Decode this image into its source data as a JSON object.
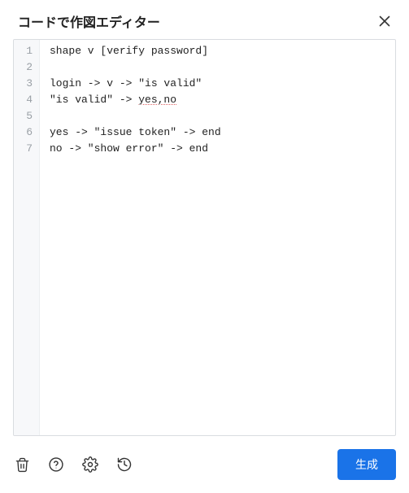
{
  "header": {
    "title": "コードで作図エディター"
  },
  "editor": {
    "lines": [
      {
        "n": 1,
        "text": "shape v [verify password]"
      },
      {
        "n": 2,
        "text": ""
      },
      {
        "n": 3,
        "text": "login -> v -> \"is valid\""
      },
      {
        "n": 4,
        "prefix": "\"is valid\" -> ",
        "spell": "yes,no",
        "suffix": ""
      },
      {
        "n": 5,
        "text": ""
      },
      {
        "n": 6,
        "text": "yes -> \"issue token\" -> end"
      },
      {
        "n": 7,
        "text": "no -> \"show error\" -> end"
      }
    ]
  },
  "footer": {
    "generate_label": "生成"
  },
  "icons": {
    "close": "close-icon",
    "trash": "trash-icon",
    "help": "help-icon",
    "settings": "gear-icon",
    "history": "history-icon"
  }
}
